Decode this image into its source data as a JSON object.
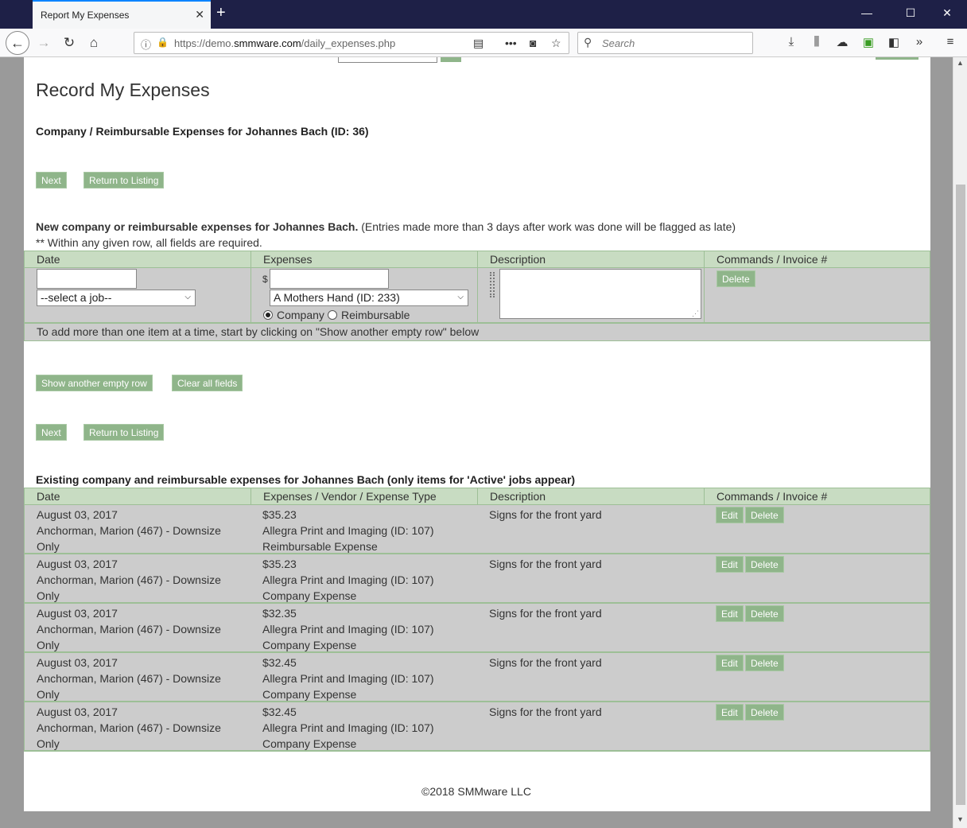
{
  "browser": {
    "tab_title": "Report My Expenses",
    "url_prefix": "https://demo.",
    "url_domain": "smmware.com",
    "url_path": "/daily_expenses.php",
    "search_placeholder": "Search"
  },
  "page": {
    "title": "Record My Expenses",
    "subtitle": "Company / Reimbursable Expenses for Johannes Bach (ID: 36)",
    "next_label": "Next",
    "return_label": "Return to Listing",
    "new_heading": "New company or reimbursable expenses for Johannes Bach.",
    "new_note": " (Entries made more than 3 days after work was done will be flagged as late)",
    "required_note": "** Within any given row, all fields are required.",
    "form": {
      "headers": [
        "Date",
        "Expenses",
        "Description",
        "Commands / Invoice #"
      ],
      "dollar": "$",
      "job_select": "--select a job--",
      "vendor_select": "A Mothers Hand (ID: 233)",
      "radio_company": "Company",
      "radio_reimbursable": "Reimbursable",
      "delete_label": "Delete",
      "hint": "To add more than one item at a time, start by clicking on \"Show another empty row\" below"
    },
    "show_row_label": "Show another empty row",
    "clear_label": "Clear all fields",
    "existing_heading": "Existing company and reimbursable expenses for Johannes Bach (only items for 'Active' jobs appear)",
    "existing_headers": [
      "Date",
      "Expenses / Vendor / Expense Type",
      "Description",
      "Commands / Invoice #"
    ],
    "edit_label": "Edit",
    "rows": [
      {
        "date": "August 03, 2017",
        "job": "Anchorman, Marion (467) - Downsize",
        "job2": "Only",
        "amount": "$35.23",
        "vendor": "Allegra Print and Imaging (ID: 107)",
        "type": "Reimbursable Expense",
        "desc": "Signs for the front yard"
      },
      {
        "date": "August 03, 2017",
        "job": "Anchorman, Marion (467) - Downsize",
        "job2": "Only",
        "amount": "$35.23",
        "vendor": "Allegra Print and Imaging (ID: 107)",
        "type": "Company Expense",
        "desc": "Signs for the front yard"
      },
      {
        "date": "August 03, 2017",
        "job": "Anchorman, Marion (467) - Downsize",
        "job2": "Only",
        "amount": "$32.35",
        "vendor": "Allegra Print and Imaging (ID: 107)",
        "type": "Company Expense",
        "desc": "Signs for the front yard"
      },
      {
        "date": "August 03, 2017",
        "job": "Anchorman, Marion (467) - Downsize",
        "job2": "Only",
        "amount": "$32.45",
        "vendor": "Allegra Print and Imaging (ID: 107)",
        "type": "Company Expense",
        "desc": "Signs for the front yard"
      },
      {
        "date": "August 03, 2017",
        "job": "Anchorman, Marion (467) - Downsize",
        "job2": "Only",
        "amount": "$32.45",
        "vendor": "Allegra Print and Imaging (ID: 107)",
        "type": "Company Expense",
        "desc": "Signs for the front yard"
      }
    ],
    "footer": "©2018 SMMware LLC"
  }
}
